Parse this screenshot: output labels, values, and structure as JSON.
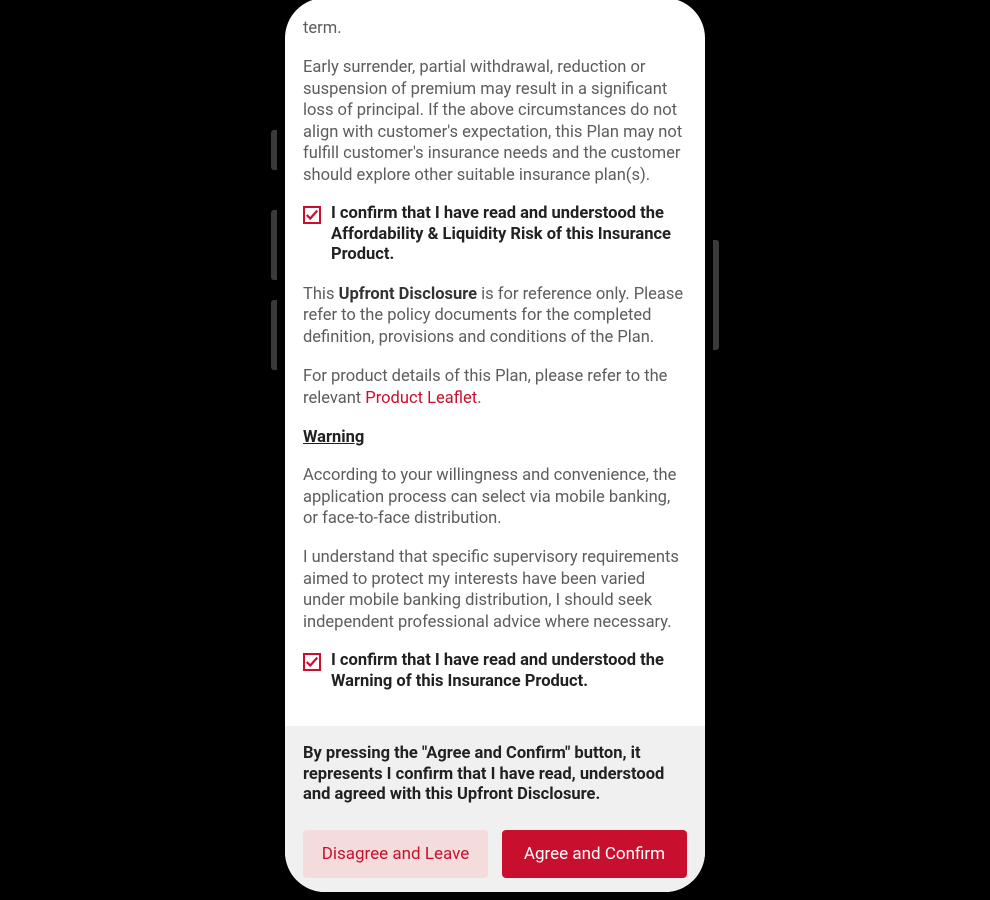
{
  "colors": {
    "accent": "#c8102e"
  },
  "content": {
    "para_term_tail": "term.",
    "para_surrender": "Early surrender, partial withdrawal, reduction or suspension of premium may result in a significant loss of principal. If the above circumstances do not align with customer's expectation, this Plan may not fulfill customer's insurance needs and the customer should explore other suitable insurance plan(s).",
    "confirm_affordability": "I confirm that I have read and understood the Affordability & Liquidity Risk of this Insurance Product.",
    "upfront_pre": "This ",
    "upfront_bold": "Upfront Disclosure",
    "upfront_post": " is for reference only. Please refer to the policy documents for the completed definition, provisions and conditions of the Plan.",
    "leaflet_pre": "For product details of this Plan, please refer to the relevant ",
    "leaflet_link": "Product Leaflet",
    "leaflet_post": ".",
    "warning_heading": "Warning",
    "warning_p1": "According to your willingness and convenience, the application process can select via mobile banking, or face-to-face distribution.",
    "warning_p2": "I understand that specific supervisory requirements aimed to protect my interests have been varied under mobile banking distribution, I should seek independent professional advice where necessary.",
    "confirm_warning": "I confirm that I have read and understood the Warning of this Insurance Product."
  },
  "footer": {
    "text": "By pressing the \"Agree and Confirm\" button, it represents I confirm that I have read, understood and agreed with this Upfront Disclosure.",
    "disagree_label": "Disagree and Leave",
    "agree_label": "Agree and Confirm"
  },
  "checkboxes": {
    "affordability_checked": true,
    "warning_checked": true
  }
}
